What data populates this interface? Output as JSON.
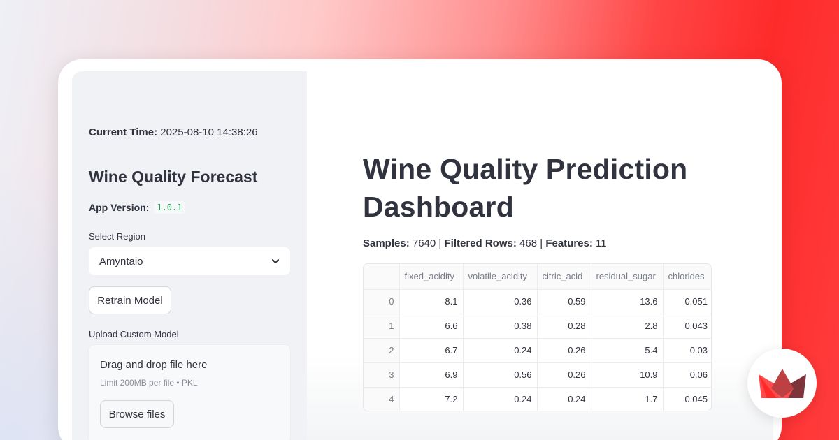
{
  "sidebar": {
    "time_label": "Current Time:",
    "time_value": "2025-08-10 14:38:26",
    "title": "Wine Quality Forecast",
    "version_label": "App Version:",
    "version_value": "1.0.1",
    "region_label": "Select Region",
    "region_value": "Amyntaio",
    "retrain_label": "Retrain Model",
    "upload_label": "Upload Custom Model",
    "drop_title": "Drag and drop file here",
    "drop_sub": "Limit 200MB per file • PKL",
    "browse_label": "Browse files"
  },
  "main": {
    "title": "Wine Quality Prediction Dashboard",
    "samples_label": "Samples:",
    "samples_value": "7640",
    "filtered_label": "Filtered Rows:",
    "filtered_value": "468",
    "features_label": "Features:",
    "features_value": "11",
    "sep": "|"
  },
  "table": {
    "columns": [
      "",
      "fixed_acidity",
      "volatile_acidity",
      "citric_acid",
      "residual_sugar",
      "chlorides"
    ],
    "rows": [
      [
        "0",
        "8.1",
        "0.36",
        "0.59",
        "13.6",
        "0.051"
      ],
      [
        "1",
        "6.6",
        "0.38",
        "0.28",
        "2.8",
        "0.043"
      ],
      [
        "2",
        "6.7",
        "0.24",
        "0.26",
        "5.4",
        "0.03"
      ],
      [
        "3",
        "6.9",
        "0.56",
        "0.26",
        "10.9",
        "0.06"
      ],
      [
        "4",
        "7.2",
        "0.24",
        "0.24",
        "1.7",
        "0.045"
      ]
    ]
  },
  "icons": {
    "select_chevron": "chevron-down-icon",
    "logo": "streamlit-logo-icon"
  },
  "colors": {
    "accent": "#ff2b2b",
    "sidebar_bg": "#f0f2f6",
    "code_green": "#1f9c4c"
  }
}
